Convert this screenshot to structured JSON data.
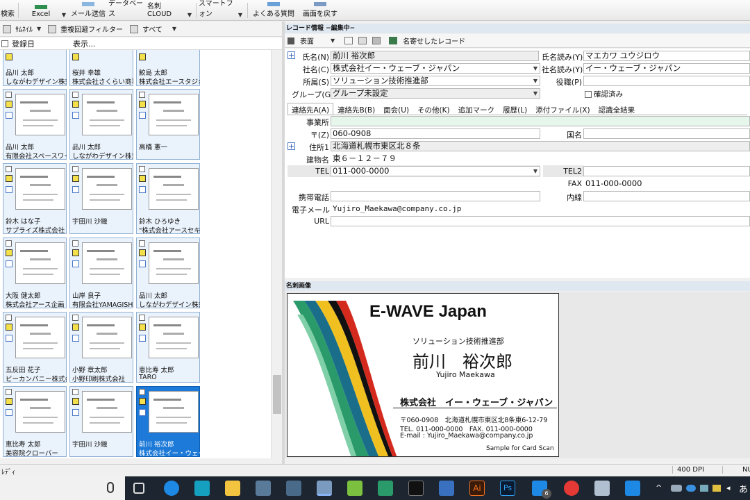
{
  "toolbar": {
    "search": "検索",
    "excel": "Excel",
    "mail": "メール送信",
    "database": "データベース",
    "cloud": "名刺CLOUD",
    "smartphone": "スマートフォン",
    "faq": "よくある質問",
    "back": "画面を戻す"
  },
  "left": {
    "thumb_label": "ｻﾑﾈｲﾙ",
    "dup_filter": "重複回避フィルター",
    "all_label": "すべて",
    "reg_date": "登録日",
    "display": "表示...",
    "top_cards": [
      {
        "n1": "品川 太郎",
        "n2": "しながわデザイン株式..."
      },
      {
        "n1": "桜井 幸雄",
        "n2": "株式会社さくらい商事"
      },
      {
        "n1": "鮫島 太郎",
        "n2": "株式会社エースタジオ"
      }
    ],
    "cards": [
      {
        "n1": "品川 太郎",
        "n2": "有限会社スペースワー..."
      },
      {
        "n1": "品川 太郎",
        "n2": "しながわデザイン株式..."
      },
      {
        "n1": "高橋 憲一",
        "n2": ""
      },
      {
        "n1": "鈴木 はな子",
        "n2": "サプライズ株式会社"
      },
      {
        "n1": "宇田川 沙織",
        "n2": ""
      },
      {
        "n1": "鈴木 ひろゆき",
        "n2": "\"株式会社アースセキュ..."
      },
      {
        "n1": "大阪 健太郎",
        "n2": "株式会社アース企画"
      },
      {
        "n1": "山岸 良子",
        "n2": "有限会社YAMAGISHI"
      },
      {
        "n1": "品川 太郎",
        "n2": "しながわデザイン株式..."
      },
      {
        "n1": "五反田 花子",
        "n2": "ビーカンパニー株式会..."
      },
      {
        "n1": "小野 章太郎",
        "n2": "小野印刷株式会社"
      },
      {
        "n1": "恵比寿 太郎",
        "n2": "TARO"
      },
      {
        "n1": "恵比寿 太郎",
        "n2": "美容院クローバー"
      },
      {
        "n1": "宇田川 沙織",
        "n2": ""
      },
      {
        "n1": "前川 裕次郎",
        "n2": "株式会社イー・ウェーブ..."
      }
    ]
  },
  "record": {
    "header": "レコード情報 −編集中−",
    "face": "表面",
    "similar": "名寄せしたレコード",
    "name_label": "氏名(N)",
    "name": "前川 裕次郎",
    "yomi_label": "氏名読み(Y)",
    "yomi": "マエカワ ユウジロウ",
    "company_label": "社名(C)",
    "company": "株式会社イー・ウェーブ・ジャパン",
    "company_yomi_label": "社名読み(Y)",
    "company_yomi": "イー・ウェーブ・ジャパン",
    "dept_label": "所属(S)",
    "dept": "ソリューション技術推進部",
    "title_label": "役職(P)",
    "title": "",
    "group_label": "グループ(G)",
    "group": "グループ未設定",
    "confirmed": "確認済み",
    "tabs": [
      "連絡先A(A)",
      "連絡先B(B)",
      "面会(U)",
      "その他(K)",
      "追加マーク",
      "履歴(L)",
      "添付ファイル(X)",
      "認識全結果"
    ],
    "office_label": "事業所",
    "office": "",
    "zip_label": "〒(Z)",
    "zip": "060-0908",
    "country_label": "国名",
    "country": "",
    "addr1_label": "住所1",
    "addr1": "北海道札幌市東区北８条",
    "bldg_label": "建物名",
    "bldg": "東６－１２－７９",
    "tel_label": "TEL",
    "tel": "011-000-0000",
    "tel2_label": "TEL2",
    "tel2": "",
    "fax_label": "FAX",
    "fax": "011-000-0000",
    "mobile_label": "携帯電話",
    "mobile": "",
    "ext_label": "内線",
    "ext": "",
    "email_label": "電子メール",
    "email": "Yujiro_Maekawa@company.co.jp",
    "url_label": "URL",
    "url": ""
  },
  "image": {
    "header": "名刺画像",
    "company_en": "E-WAVE Japan",
    "dept": "ソリューション技術推進部",
    "name": "前川　裕次郎",
    "name_en": "Yujiro Maekawa",
    "company": "株式会社　イー・ウェーブ・ジャパン",
    "addr": "〒060-0908　北海道札幌市東区北8条東6-12-79",
    "telfax": "TEL. 011-000-0000　FAX. 011-000-0000",
    "email": "E-mail : Yujiro_Maekawa@company.co.jp",
    "sample": "Sample for Card Scan"
  },
  "status": {
    "ready": "ﾚﾃﾞｨ",
    "dpi": "400 DPI",
    "nu": "NU"
  },
  "taskbar": {
    "mail_count": "6",
    "ime": "あ"
  }
}
